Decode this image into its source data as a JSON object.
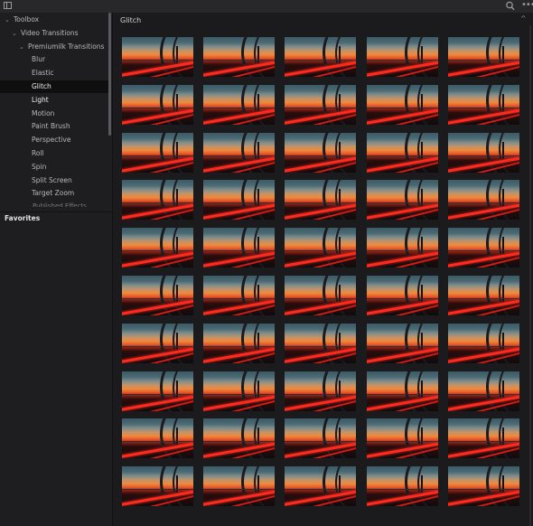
{
  "toolbar": {
    "panel_toggle_icon": "panel-toggle-icon",
    "search_icon": "search-icon",
    "more_label": "•••"
  },
  "sidebar": {
    "tree": [
      {
        "label": "Toolbox",
        "level": 0,
        "expanded": true
      },
      {
        "label": "Video Transitions",
        "level": 1,
        "expanded": true
      },
      {
        "label": "Premiumilk Transitions",
        "level": 2,
        "expanded": true
      },
      {
        "label": "Blur",
        "level": 3
      },
      {
        "label": "Elastic",
        "level": 3
      },
      {
        "label": "Glitch",
        "level": 3,
        "selected": true
      },
      {
        "label": "Light",
        "level": 3
      },
      {
        "label": "Motion",
        "level": 3
      },
      {
        "label": "Paint Brush",
        "level": 3
      },
      {
        "label": "Perspective",
        "level": 3
      },
      {
        "label": "Roll",
        "level": 3
      },
      {
        "label": "Spin",
        "level": 3
      },
      {
        "label": "Split Screen",
        "level": 3
      },
      {
        "label": "Target Zoom",
        "level": 3
      }
    ],
    "cutoff_item": "Published Effects",
    "favorites_title": "Favorites"
  },
  "main": {
    "title": "Glitch",
    "collapse_icon": "chevron-up-icon",
    "grid": {
      "columns": 5,
      "rows": 10
    }
  },
  "colors": {
    "background": "#1b1b1e",
    "sidebar": "#1e1e21",
    "selected_row": "#0f0f10",
    "light_trail": "#ff2a1e"
  }
}
